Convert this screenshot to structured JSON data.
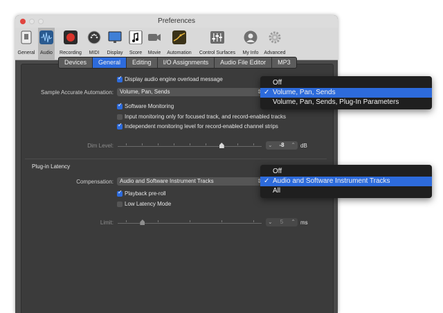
{
  "window": {
    "title": "Preferences"
  },
  "toolbar": {
    "items": [
      {
        "label": "General",
        "icon": "switch-icon",
        "color": "#e9e9e9"
      },
      {
        "label": "Audio",
        "icon": "waveform-icon",
        "color": "#2a5a8f"
      },
      {
        "label": "Recording",
        "icon": "record-icon",
        "color": "#d9342b"
      },
      {
        "label": "MIDI",
        "icon": "midi-icon",
        "color": "#3a3a3a"
      },
      {
        "label": "Display",
        "icon": "display-icon",
        "color": "#3f7fd6"
      },
      {
        "label": "Score",
        "icon": "score-icon",
        "color": "#fafafa"
      },
      {
        "label": "Movie",
        "icon": "camera-icon",
        "color": "#6d6d6d"
      },
      {
        "label": "Automation",
        "icon": "automation-icon",
        "color": "#3a3218"
      },
      {
        "label": "Control Surfaces",
        "icon": "mixer-icon",
        "color": "#6a6a6a"
      },
      {
        "label": "My Info",
        "icon": "user-icon",
        "color": "#707070"
      },
      {
        "label": "Advanced",
        "icon": "gear-icon",
        "color": "#9a9a9a"
      }
    ]
  },
  "tabs": [
    {
      "label": "Devices"
    },
    {
      "label": "General"
    },
    {
      "label": "Editing"
    },
    {
      "label": "I/O Assignments"
    },
    {
      "label": "Audio File Editor"
    },
    {
      "label": "MP3"
    }
  ],
  "general": {
    "display_overload": {
      "label": "Display audio engine overload message",
      "checked": true
    },
    "sample_accurate": {
      "label": "Sample Accurate Automation:",
      "value": "Volume, Pan, Sends"
    },
    "software_monitoring": {
      "label": "Software Monitoring",
      "checked": true
    },
    "input_monitoring": {
      "label": "Input monitoring only for focused track, and record-enabled tracks",
      "checked": false
    },
    "independent_monitoring": {
      "label": "Independent monitoring level for record-enabled channel strips",
      "checked": true
    },
    "dim_level": {
      "label": "Dim Level:",
      "value": "-8",
      "unit": "dB",
      "level": 0.72
    }
  },
  "plugin_latency": {
    "heading": "Plug-in Latency",
    "compensation": {
      "label": "Compensation:",
      "value": "Audio and Software Instrument Tracks"
    },
    "playback_preroll": {
      "label": "Playback pre-roll",
      "checked": true
    },
    "low_latency": {
      "label": "Low Latency Mode",
      "checked": false
    },
    "limit": {
      "label": "Limit:",
      "value": "5",
      "unit": "ms",
      "level": 0.17
    }
  },
  "automation_menu": {
    "items": [
      "Off",
      "Volume, Pan, Sends",
      "Volume, Pan, Sends, Plug-In Parameters"
    ],
    "selected": "Volume, Pan, Sends"
  },
  "compensation_menu": {
    "items": [
      "Off",
      "Audio and Software Instrument Tracks",
      "All"
    ],
    "selected": "Audio and Software Instrument Tracks"
  },
  "colors": {
    "accent": "#2d6bdc",
    "panel": "#3b3b3b"
  }
}
